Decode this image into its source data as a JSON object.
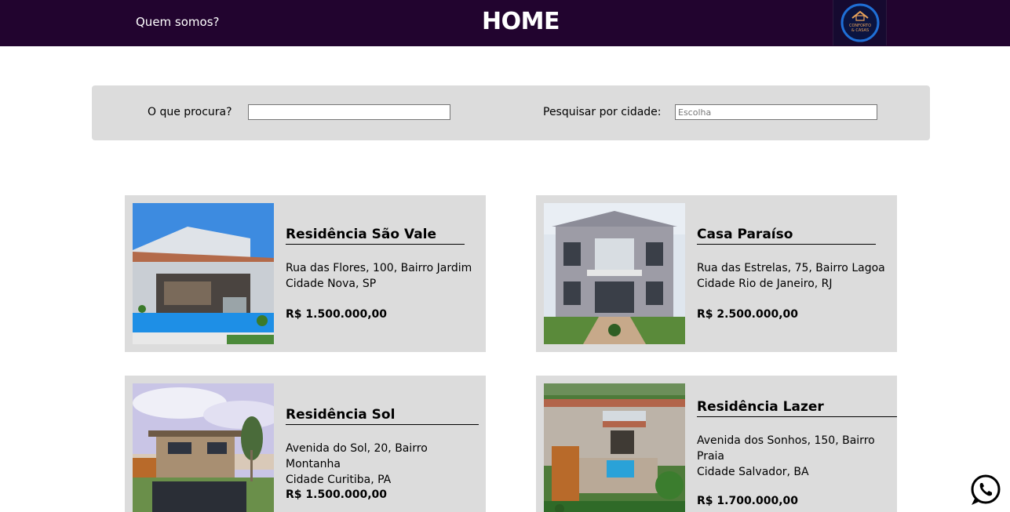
{
  "header": {
    "nav_link": "Quem somos?",
    "title": "HOME",
    "logo_text_line1": "CONFORTO",
    "logo_text_line2": "& CASAS",
    "bg_color": "#22042f"
  },
  "search": {
    "query_label": "O que procura?",
    "query_value": "",
    "city_label": "Pesquisar por cidade:",
    "city_placeholder": "Escolha"
  },
  "listings": [
    {
      "title": "Residência São Vale",
      "address_line1": "Rua das Flores, 100, Bairro Jardim",
      "address_line2": "Cidade Nova, SP",
      "price": "R$ 1.500.000,00"
    },
    {
      "title": "Casa Paraíso",
      "address_line1": "Rua das Estrelas, 75, Bairro Lagoa",
      "address_line2": "Cidade Rio de Janeiro, RJ",
      "price": "R$ 2.500.000,00"
    },
    {
      "title": "Residência Sol",
      "address_line1": "Avenida do Sol, 20, Bairro Montanha",
      "address_line2": "Cidade Curitiba, PA",
      "price": "R$ 1.500.000,00"
    },
    {
      "title": "Residência Lazer",
      "address_line1": "Avenida dos Sonhos, 150, Bairro Praia",
      "address_line2": "Cidade Salvador, BA",
      "price": "R$ 1.700.000,00"
    }
  ],
  "floating": {
    "icon": "whatsapp-icon"
  }
}
